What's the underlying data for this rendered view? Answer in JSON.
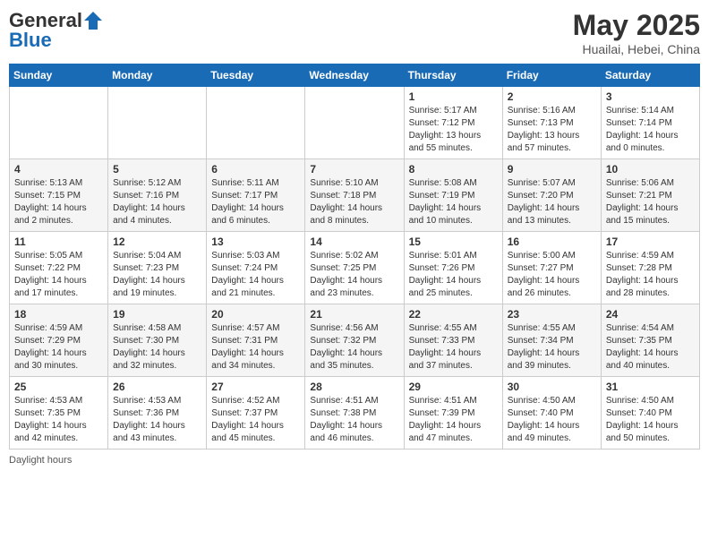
{
  "header": {
    "logo_general": "General",
    "logo_blue": "Blue",
    "title": "May 2025",
    "location": "Huailai, Hebei, China"
  },
  "days_of_week": [
    "Sunday",
    "Monday",
    "Tuesday",
    "Wednesday",
    "Thursday",
    "Friday",
    "Saturday"
  ],
  "footer": {
    "daylight_label": "Daylight hours"
  },
  "weeks": [
    [
      {
        "day": "",
        "info": ""
      },
      {
        "day": "",
        "info": ""
      },
      {
        "day": "",
        "info": ""
      },
      {
        "day": "",
        "info": ""
      },
      {
        "day": "1",
        "info": "Sunrise: 5:17 AM\nSunset: 7:12 PM\nDaylight: 13 hours\nand 55 minutes."
      },
      {
        "day": "2",
        "info": "Sunrise: 5:16 AM\nSunset: 7:13 PM\nDaylight: 13 hours\nand 57 minutes."
      },
      {
        "day": "3",
        "info": "Sunrise: 5:14 AM\nSunset: 7:14 PM\nDaylight: 14 hours\nand 0 minutes."
      }
    ],
    [
      {
        "day": "4",
        "info": "Sunrise: 5:13 AM\nSunset: 7:15 PM\nDaylight: 14 hours\nand 2 minutes."
      },
      {
        "day": "5",
        "info": "Sunrise: 5:12 AM\nSunset: 7:16 PM\nDaylight: 14 hours\nand 4 minutes."
      },
      {
        "day": "6",
        "info": "Sunrise: 5:11 AM\nSunset: 7:17 PM\nDaylight: 14 hours\nand 6 minutes."
      },
      {
        "day": "7",
        "info": "Sunrise: 5:10 AM\nSunset: 7:18 PM\nDaylight: 14 hours\nand 8 minutes."
      },
      {
        "day": "8",
        "info": "Sunrise: 5:08 AM\nSunset: 7:19 PM\nDaylight: 14 hours\nand 10 minutes."
      },
      {
        "day": "9",
        "info": "Sunrise: 5:07 AM\nSunset: 7:20 PM\nDaylight: 14 hours\nand 13 minutes."
      },
      {
        "day": "10",
        "info": "Sunrise: 5:06 AM\nSunset: 7:21 PM\nDaylight: 14 hours\nand 15 minutes."
      }
    ],
    [
      {
        "day": "11",
        "info": "Sunrise: 5:05 AM\nSunset: 7:22 PM\nDaylight: 14 hours\nand 17 minutes."
      },
      {
        "day": "12",
        "info": "Sunrise: 5:04 AM\nSunset: 7:23 PM\nDaylight: 14 hours\nand 19 minutes."
      },
      {
        "day": "13",
        "info": "Sunrise: 5:03 AM\nSunset: 7:24 PM\nDaylight: 14 hours\nand 21 minutes."
      },
      {
        "day": "14",
        "info": "Sunrise: 5:02 AM\nSunset: 7:25 PM\nDaylight: 14 hours\nand 23 minutes."
      },
      {
        "day": "15",
        "info": "Sunrise: 5:01 AM\nSunset: 7:26 PM\nDaylight: 14 hours\nand 25 minutes."
      },
      {
        "day": "16",
        "info": "Sunrise: 5:00 AM\nSunset: 7:27 PM\nDaylight: 14 hours\nand 26 minutes."
      },
      {
        "day": "17",
        "info": "Sunrise: 4:59 AM\nSunset: 7:28 PM\nDaylight: 14 hours\nand 28 minutes."
      }
    ],
    [
      {
        "day": "18",
        "info": "Sunrise: 4:59 AM\nSunset: 7:29 PM\nDaylight: 14 hours\nand 30 minutes."
      },
      {
        "day": "19",
        "info": "Sunrise: 4:58 AM\nSunset: 7:30 PM\nDaylight: 14 hours\nand 32 minutes."
      },
      {
        "day": "20",
        "info": "Sunrise: 4:57 AM\nSunset: 7:31 PM\nDaylight: 14 hours\nand 34 minutes."
      },
      {
        "day": "21",
        "info": "Sunrise: 4:56 AM\nSunset: 7:32 PM\nDaylight: 14 hours\nand 35 minutes."
      },
      {
        "day": "22",
        "info": "Sunrise: 4:55 AM\nSunset: 7:33 PM\nDaylight: 14 hours\nand 37 minutes."
      },
      {
        "day": "23",
        "info": "Sunrise: 4:55 AM\nSunset: 7:34 PM\nDaylight: 14 hours\nand 39 minutes."
      },
      {
        "day": "24",
        "info": "Sunrise: 4:54 AM\nSunset: 7:35 PM\nDaylight: 14 hours\nand 40 minutes."
      }
    ],
    [
      {
        "day": "25",
        "info": "Sunrise: 4:53 AM\nSunset: 7:35 PM\nDaylight: 14 hours\nand 42 minutes."
      },
      {
        "day": "26",
        "info": "Sunrise: 4:53 AM\nSunset: 7:36 PM\nDaylight: 14 hours\nand 43 minutes."
      },
      {
        "day": "27",
        "info": "Sunrise: 4:52 AM\nSunset: 7:37 PM\nDaylight: 14 hours\nand 45 minutes."
      },
      {
        "day": "28",
        "info": "Sunrise: 4:51 AM\nSunset: 7:38 PM\nDaylight: 14 hours\nand 46 minutes."
      },
      {
        "day": "29",
        "info": "Sunrise: 4:51 AM\nSunset: 7:39 PM\nDaylight: 14 hours\nand 47 minutes."
      },
      {
        "day": "30",
        "info": "Sunrise: 4:50 AM\nSunset: 7:40 PM\nDaylight: 14 hours\nand 49 minutes."
      },
      {
        "day": "31",
        "info": "Sunrise: 4:50 AM\nSunset: 7:40 PM\nDaylight: 14 hours\nand 50 minutes."
      }
    ]
  ]
}
